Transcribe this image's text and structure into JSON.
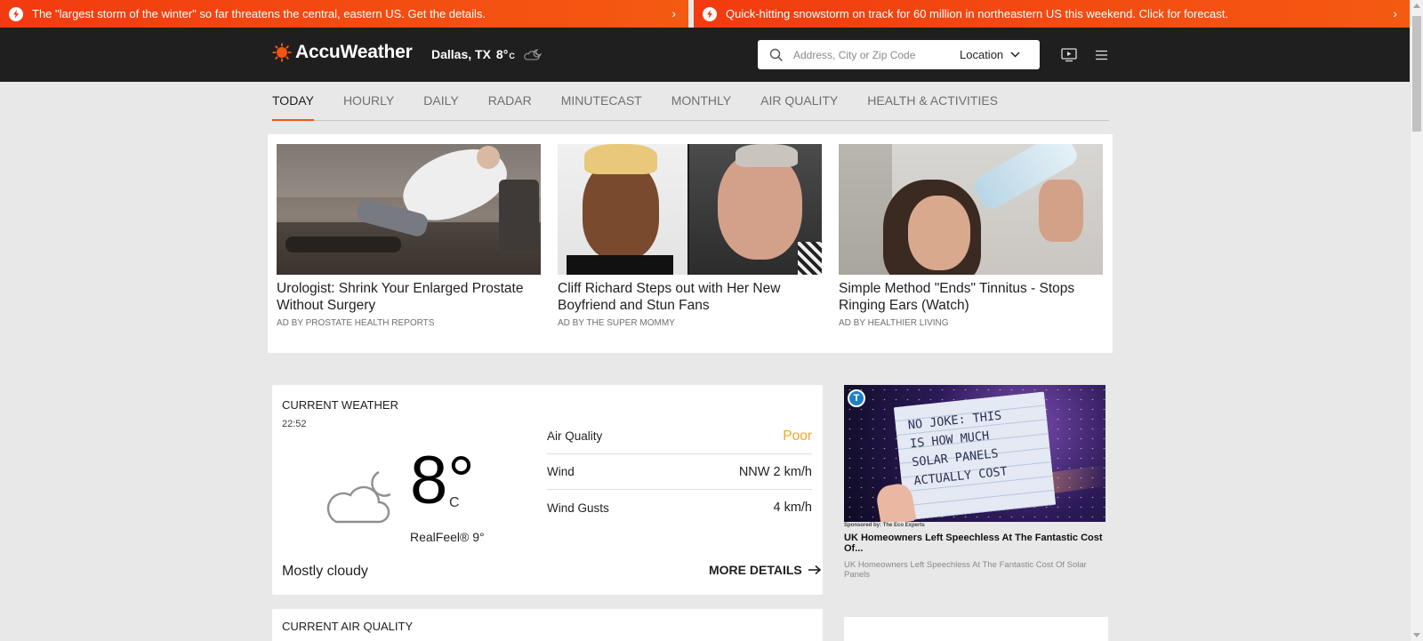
{
  "alerts": [
    {
      "text": "The \"largest storm of the winter\" so far threatens the central, eastern US. Get the details."
    },
    {
      "text": "Quick-hitting snowstorm on track for 60 million in northeastern US this weekend. Click for forecast."
    }
  ],
  "header": {
    "brand": "AccuWeather",
    "location": "Dallas, TX",
    "temp": "8°",
    "unit": "C",
    "search_placeholder": "Address, City or Zip Code",
    "location_button": "Location"
  },
  "nav": {
    "tabs": [
      "TODAY",
      "HOURLY",
      "DAILY",
      "RADAR",
      "MINUTECAST",
      "MONTHLY",
      "AIR QUALITY",
      "HEALTH & ACTIVITIES"
    ],
    "active": "TODAY"
  },
  "ads": [
    {
      "title": "Urologist: Shrink Your Enlarged Prostate Without Surgery",
      "source": "AD BY PROSTATE HEALTH REPORTS"
    },
    {
      "title": "Cliff Richard Steps out with Her New Boyfriend and Stun Fans",
      "source": "AD BY THE SUPER MOMMY"
    },
    {
      "title": "Simple Method \"Ends\" Tinnitus - Stops Ringing Ears (Watch)",
      "source": "AD BY HEALTHIER LIVING"
    }
  ],
  "current_weather": {
    "heading": "CURRENT WEATHER",
    "time": "22:52",
    "temp": "8°",
    "unit": "C",
    "realfeel": "RealFeel® 9°",
    "phrase": "Mostly cloudy",
    "more_details": "MORE DETAILS",
    "details": [
      {
        "label": "Air Quality",
        "value": "Poor"
      },
      {
        "label": "Wind",
        "value": "NNW 2 km/h"
      },
      {
        "label": "Wind Gusts",
        "value": "4 km/h"
      }
    ]
  },
  "air_quality_card": {
    "heading": "CURRENT AIR QUALITY"
  },
  "right_ad": {
    "badge": "T",
    "image_text": [
      "NO JOKE: THIS",
      "IS HOW MUCH",
      "SOLAR PANELS",
      "ACTUALLY COST"
    ],
    "sponsor": "Sponsored by: The Eco Experts",
    "title": "UK Homeowners Left Speechless At The Fantastic Cost Of...",
    "desc": "UK Homeowners Left Speechless At The Fantastic Cost Of Solar Panels"
  },
  "colors": {
    "accent": "#f05514",
    "header_bg": "#1f1f1f",
    "alert_bg": "#f23b10",
    "poor": "#f0a81e",
    "page_bg": "#e8e8e8"
  },
  "icons": {
    "alert": "lightning-bolt-icon",
    "logo": "sun-logo-icon",
    "header_weather": "cloud-moon-icon",
    "search": "magnifier-icon",
    "dropdown": "chevron-down-icon",
    "video": "video-play-icon",
    "menu": "hamburger-menu-icon",
    "weather": "cloud-moon-icon",
    "more": "arrow-right-icon"
  }
}
